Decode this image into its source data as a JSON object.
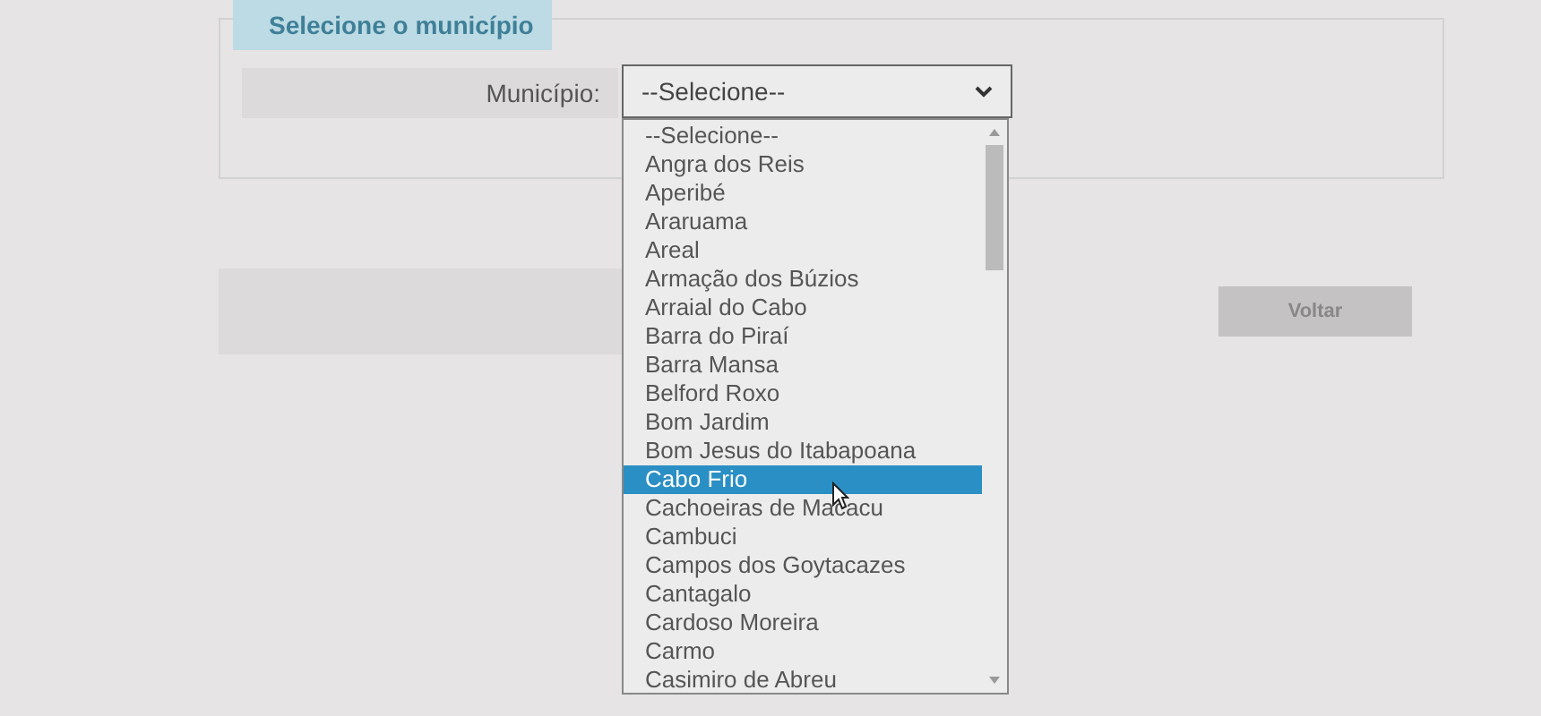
{
  "fieldset": {
    "legend": "Selecione o município"
  },
  "field": {
    "label": "Município:",
    "value": "--Selecione--"
  },
  "dropdown": {
    "options": [
      {
        "label": "--Selecione--",
        "selected": false
      },
      {
        "label": "Angra dos Reis",
        "selected": false
      },
      {
        "label": "Aperibé",
        "selected": false
      },
      {
        "label": "Araruama",
        "selected": false
      },
      {
        "label": "Areal",
        "selected": false
      },
      {
        "label": "Armação dos Búzios",
        "selected": false
      },
      {
        "label": "Arraial do Cabo",
        "selected": false
      },
      {
        "label": "Barra do Piraí",
        "selected": false
      },
      {
        "label": "Barra Mansa",
        "selected": false
      },
      {
        "label": "Belford Roxo",
        "selected": false
      },
      {
        "label": "Bom Jardim",
        "selected": false
      },
      {
        "label": "Bom Jesus do Itabapoana",
        "selected": false
      },
      {
        "label": "Cabo Frio",
        "selected": true
      },
      {
        "label": "Cachoeiras de Macacu",
        "selected": false
      },
      {
        "label": "Cambuci",
        "selected": false
      },
      {
        "label": "Campos dos Goytacazes",
        "selected": false
      },
      {
        "label": "Cantagalo",
        "selected": false
      },
      {
        "label": "Cardoso Moreira",
        "selected": false
      },
      {
        "label": "Carmo",
        "selected": false
      },
      {
        "label": "Casimiro de Abreu",
        "selected": false
      }
    ]
  },
  "back_button": "Voltar"
}
